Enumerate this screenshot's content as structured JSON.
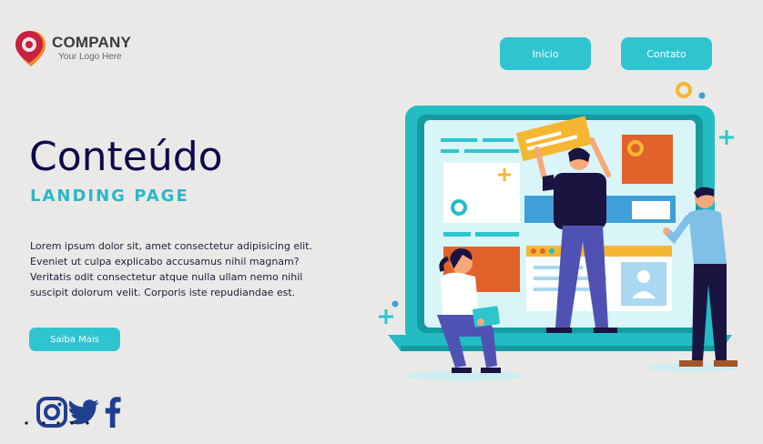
{
  "brand": {
    "name": "COMPANY",
    "tagline": "Your Logo Here",
    "colors": {
      "red": "#c8203f",
      "orange": "#f08a24",
      "teal": "#2ec5d0",
      "navy": "#0c0a4b"
    }
  },
  "nav": {
    "items": [
      {
        "label": "Início"
      },
      {
        "label": "Contato"
      }
    ]
  },
  "hero": {
    "title": "Conteúdo",
    "subtitle": "LANDING PAGE",
    "body": "Lorem ipsum dolor sit, amet consectetur adipisicing elit. Eveniet ut culpa explicabo accusamus nihil magnam? Veritatis odit consectetur atque nulla ullam nemo nihil suscipit dolorum velit. Corporis iste repudiandae est.",
    "cta_label": "Saiba Mais"
  },
  "social": {
    "icons": [
      "instagram-icon",
      "twitter-icon",
      "facebook-icon"
    ],
    "color": "#1f3f8f"
  }
}
